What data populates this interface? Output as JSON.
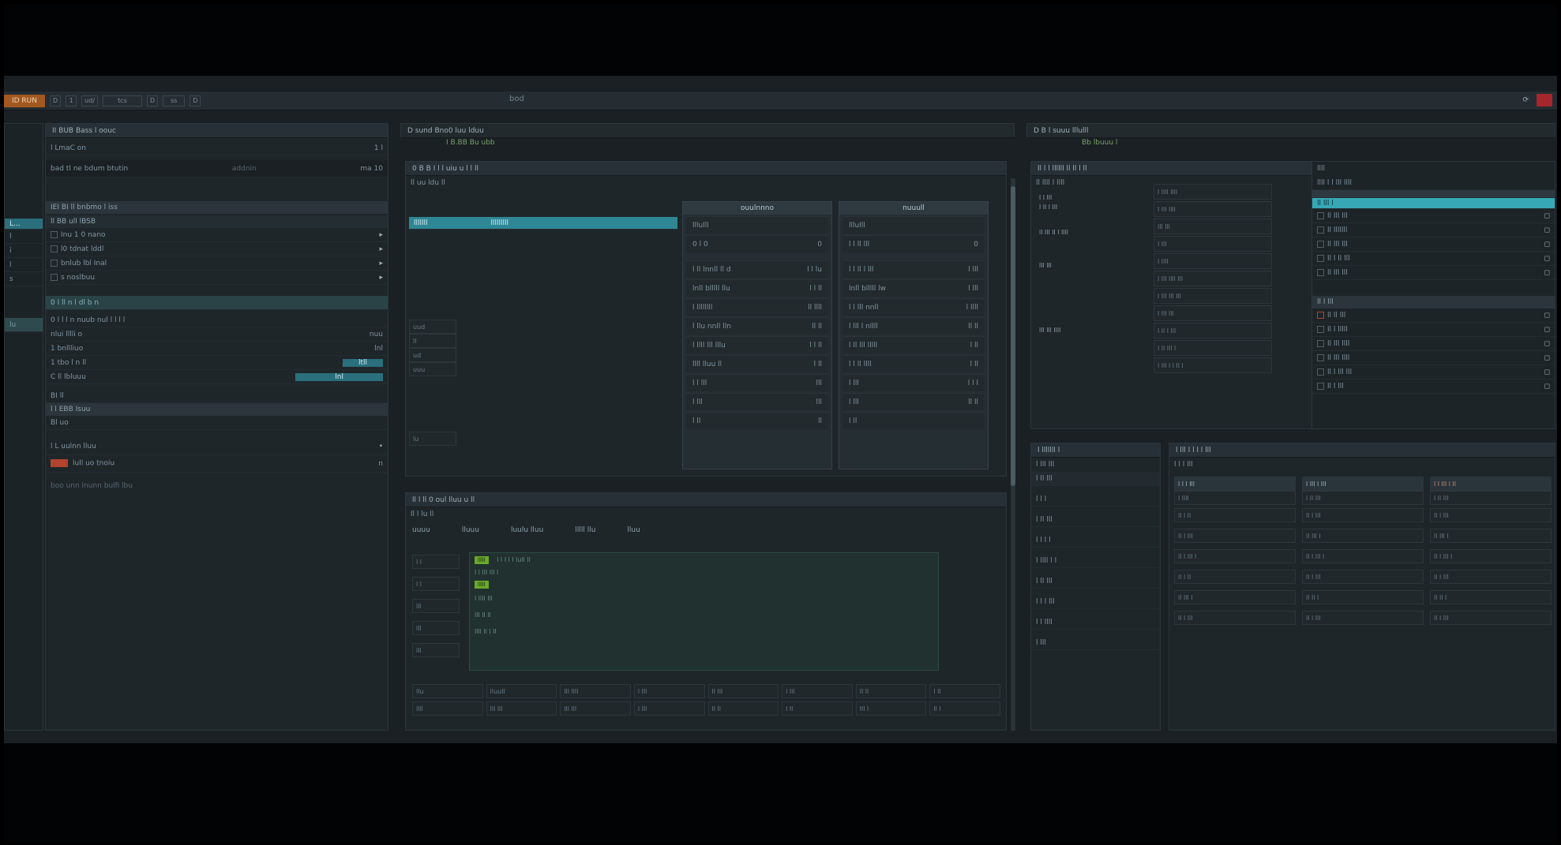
{
  "titlebar": {
    "app_badge": "ID RUN",
    "buttons": [
      "D",
      "1",
      "ud/",
      "tcs",
      "D",
      "ss",
      "D"
    ],
    "title": "bod",
    "right_icon": "refresh-icon"
  },
  "left_panel": {
    "header": "II BUB  Bass l oouc",
    "search_label": "l LmaC on",
    "search_right": "1 l",
    "info_row": {
      "label": "bad tl ne bdum btutin",
      "value": "addnin",
      "extra": "ma 10"
    },
    "subhead": "IEI BI ll bnbmo l iss",
    "tree_header": "ll BB ull lBSB",
    "rows": [
      {
        "label": "Inu 1 0 nano",
        "value": ""
      },
      {
        "label": "l0 tdnat lddl",
        "value": ""
      },
      {
        "label": "bnlub lbl Inal",
        "value": ""
      },
      {
        "label": "s noslbuu",
        "value": ""
      }
    ],
    "toolbar_row": "0 l  ll  n  l  dl  b  n",
    "mid_row": "0 l l l  n nuub  nul  l l  l l",
    "status_rows": [
      {
        "label": "nlui lllli o",
        "value": "nuu"
      },
      {
        "label": "1 bnllliuo",
        "value": "lnl"
      },
      {
        "label": "1 tbo l n  ll",
        "value": "ltll"
      },
      {
        "label": "C ll  lbluuu",
        "value": "lnl"
      }
    ],
    "section_a": "BI  ll",
    "section_b": "l l EBB  Isuu",
    "section_c": "Bl  uo",
    "list_items": [
      {
        "label": "l L  uulnn lluu",
        "value": ""
      },
      {
        "label": "lull  uo  tnoiu",
        "value": "n"
      }
    ],
    "footer_note": "boo unn lnunn  bulfi lbu"
  },
  "side_strip": {
    "items": [
      "L...",
      "l",
      "i",
      "l",
      "s",
      "lu"
    ]
  },
  "center_top": {
    "header": "D  sund  Bno0 luu lduu",
    "subheader": "I  B.BB  Bu ubb",
    "section_title": "0 B  B I  l l  uiu u  l l ll",
    "label": "ll uu ldu ll",
    "selected_row": {
      "left": "lllllll",
      "right": "lllllllll"
    },
    "left_labels": [
      "uud",
      "ll",
      "ud",
      "uuu",
      "lu"
    ],
    "cards": [
      {
        "title": "ouulnnno",
        "rows": [
          {
            "label": "lllulll",
            "value": ""
          },
          {
            "label": "0 l 0",
            "value": "0"
          },
          {
            "label": "l ll  lnnll ll  d",
            "value": "l l  lu"
          },
          {
            "label": "lnll blllll llu",
            "value": "l l ll"
          },
          {
            "label": "l  llllllll",
            "value": "ll  llll"
          },
          {
            "label": "l llu  nnll  lln",
            "value": "ll  ll"
          },
          {
            "label": "l llll  lll  lllu",
            "value": "l l  ll"
          },
          {
            "label": "llll  lluu  ll",
            "value": "l ll"
          },
          {
            "label": "l l lll",
            "value": "lll"
          },
          {
            "label": "l lll",
            "value": "lll"
          },
          {
            "label": "l ll",
            "value": "ll"
          }
        ]
      },
      {
        "title": "nuuull",
        "rows": [
          {
            "label": "lllulll",
            "value": ""
          },
          {
            "label": "l  l ll  lll",
            "value": "0"
          },
          {
            "label": "l l ll  l  lll",
            "value": "l lll"
          },
          {
            "label": "lnll  blllll  lw",
            "value": "l lll"
          },
          {
            "label": "l l  lll  nnll",
            "value": "l llll"
          },
          {
            "label": "l lll  l nllll",
            "value": "ll ll"
          },
          {
            "label": "l ll  lll  lllll",
            "value": "l ll"
          },
          {
            "label": "l l ll  llll",
            "value": "l ll"
          },
          {
            "label": "l lll",
            "value": "l l l"
          },
          {
            "label": "l lll",
            "value": "ll ll"
          },
          {
            "label": "l ll",
            "value": ""
          }
        ]
      }
    ]
  },
  "center_bottom": {
    "header": "ll l ll  0  oul   lluu u ll",
    "subheader": "ll l  lu ll",
    "columns": [
      "uuuu",
      "lluuu",
      "luulu  lluu",
      "lllll  llu",
      "lluu"
    ],
    "row_labels": [
      "l l",
      "l l",
      "lll",
      "lll",
      "lll"
    ],
    "chip_a": "lllll",
    "chip_b": "lllll",
    "lines": [
      "l l l  l l  lull  ll",
      "l l  lll lll  l",
      "l  llll  lll",
      "lll  ll ll",
      "llll ll  l ll"
    ],
    "footer_row1": [
      "llu",
      "lluull",
      "lll  llll",
      "l lll",
      "ll lll",
      "l lll",
      "ll ll",
      "l ll"
    ],
    "footer_row2": [
      "llll",
      "lll lll",
      "lll lll",
      "l lll",
      "ll ll",
      "l ll",
      "lll l",
      "ll l"
    ]
  },
  "right_top": {
    "header": "D  B  l  suuu  lllulll",
    "subheader": "Bb  lbuuu l",
    "section_title": "ll l l  llllll  ll  ll  l ll",
    "group_title": "ll llll  l llll",
    "labels": [
      "l  l  lll",
      "l ll l lll",
      "ll lll ll  l llll",
      "lll  lll",
      "lll lll llll"
    ],
    "fields": [
      "l llll  llll",
      "l lll llll",
      "lll  lll",
      "l lll",
      "l llll",
      "l lll llll  lll",
      "l lll  lll  lll",
      "l lll  lll",
      "l ll l lll",
      "l ll  lll l",
      "l lll l  l ll  l"
    ],
    "list_title": "llll",
    "list_sub": "llll  l l  lll  llll",
    "list_items": [
      {
        "label": "ll  lll l",
        "value": ""
      },
      {
        "label": "ll lll lll",
        "value": ""
      },
      {
        "label": "ll lllllll",
        "value": ""
      },
      {
        "label": "ll lll  lll",
        "value": ""
      },
      {
        "label": "ll l ll lll",
        "value": ""
      },
      {
        "label": "ll lll lll",
        "value": ""
      }
    ],
    "list2_title": "ll  l  lll",
    "list2_items": [
      {
        "label": "ll  ll lll",
        "value": ""
      },
      {
        "label": "ll  l lllll",
        "value": ""
      },
      {
        "label": "ll lll llll",
        "value": ""
      },
      {
        "label": "ll lll  llll",
        "value": ""
      },
      {
        "label": "ll l lll lll",
        "value": ""
      },
      {
        "label": "ll l lll",
        "value": ""
      }
    ]
  },
  "right_bottom": {
    "left_header": "l  lllllll  l",
    "left_items": [
      "l  lll lll",
      "l ll lll",
      "l l l",
      "l ll lll",
      "l l l l",
      "l  llll l l",
      "l ll lll",
      "l l  l lll",
      "l l  llll",
      "l lll"
    ],
    "right_header": "l lll  l  l l  l lll",
    "right_sub": "l  l  l lll",
    "columns": [
      {
        "title": "l l  l lll",
        "items": [
          "l  llll",
          "ll l ll",
          "ll  l lll",
          "ll  l lll l",
          "ll  l ll",
          "ll  lll l",
          "ll  l lll"
        ]
      },
      {
        "title": "l lll  l lll",
        "items": [
          "l  ll lll",
          "ll l lll",
          "ll  lll l",
          "ll  l lll l",
          "ll  l lll",
          "ll  ll l",
          "ll  l lll"
        ]
      },
      {
        "title": "l l lll  l ll",
        "items": [
          "l  ll lll",
          "ll l lll",
          "ll  lll l",
          "ll  l lll l",
          "ll  l lll",
          "ll  ll l",
          "ll  l lll"
        ]
      }
    ]
  },
  "colors": {
    "accent_teal": "#37a8b6",
    "badge_orange": "#a3581f",
    "close_red": "#a5262b",
    "green_chip": "#6aa82a"
  }
}
